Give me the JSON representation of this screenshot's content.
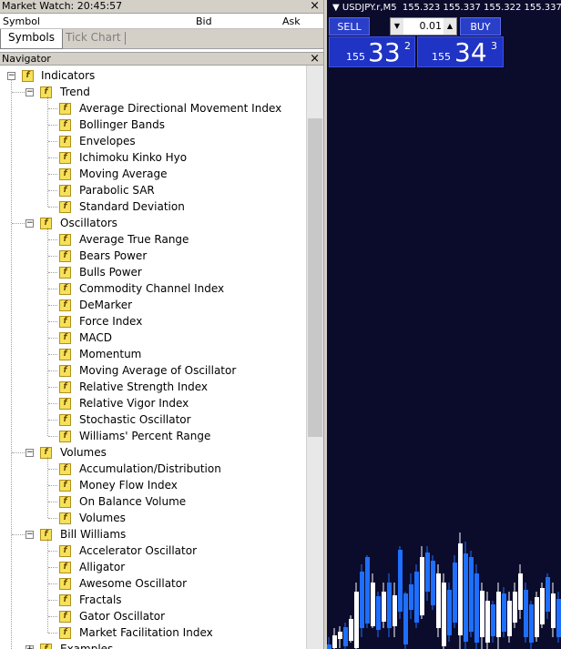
{
  "market_watch": {
    "title": "Market Watch: 20:45:57",
    "columns": [
      "Symbol",
      "Bid",
      "Ask"
    ],
    "tabs": [
      "Symbols",
      "Tick Chart"
    ]
  },
  "navigator": {
    "title": "Navigator",
    "root": "Indicators",
    "groups": [
      {
        "name": "Trend",
        "items": [
          "Average Directional Movement Index",
          "Bollinger Bands",
          "Envelopes",
          "Ichimoku Kinko Hyo",
          "Moving Average",
          "Parabolic SAR",
          "Standard Deviation"
        ]
      },
      {
        "name": "Oscillators",
        "items": [
          "Average True Range",
          "Bears Power",
          "Bulls Power",
          "Commodity Channel Index",
          "DeMarker",
          "Force Index",
          "MACD",
          "Momentum",
          "Moving Average of Oscillator",
          "Relative Strength Index",
          "Relative Vigor Index",
          "Stochastic Oscillator",
          "Williams' Percent Range"
        ]
      },
      {
        "name": "Volumes",
        "items": [
          "Accumulation/Distribution",
          "Money Flow Index",
          "On Balance Volume",
          "Volumes"
        ]
      },
      {
        "name": "Bill Williams",
        "items": [
          "Accelerator Oscillator",
          "Alligator",
          "Awesome Oscillator",
          "Fractals",
          "Gator Oscillator",
          "Market Facilitation Index"
        ]
      },
      {
        "name": "Examples",
        "items": []
      }
    ]
  },
  "chart": {
    "title": "USDJPY.r,M5",
    "ohlc": "155.323 155.337 155.322 155.337",
    "sell_label": "SELL",
    "buy_label": "BUY",
    "lot": "0.01",
    "sell_price": {
      "prefix": "155",
      "big": "33",
      "sup": "2"
    },
    "buy_price": {
      "prefix": "155",
      "big": "34",
      "sup": "3"
    },
    "colors": {
      "background": "#0b0b2c",
      "bull": "#ffffff",
      "bear": "#1e6fff",
      "button": "#2a3fc8"
    }
  }
}
